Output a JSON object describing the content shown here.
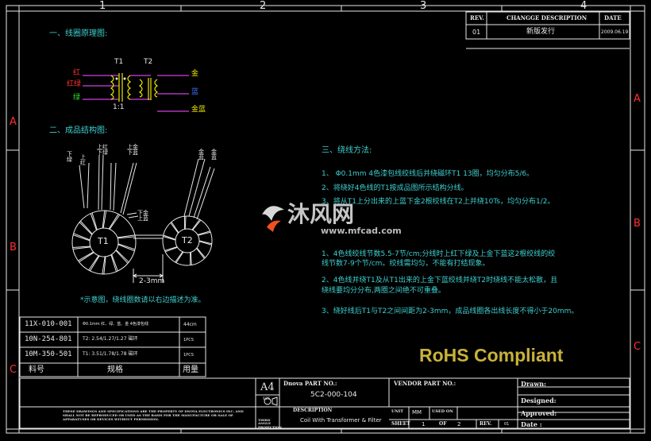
{
  "grid": {
    "cols": [
      "1",
      "2",
      "3",
      "4"
    ],
    "rows": [
      "A",
      "B",
      "C"
    ]
  },
  "revision": {
    "headers": {
      "rev": "REV.",
      "desc": "CHANGGE DESCRIPTION",
      "date": "DATE"
    },
    "rev": "01",
    "desc": "新版发行",
    "date": "2009.06.19"
  },
  "section1": {
    "title": "一、线圈原理图:"
  },
  "schematic": {
    "t1": "T1",
    "t2": "T2",
    "ratio": "1:1",
    "left_labels": [
      "红",
      "红绿",
      "绿"
    ],
    "right_labels": [
      "金",
      "蓝",
      "金蓝"
    ]
  },
  "section2": {
    "title": "二、成品结构图:"
  },
  "structure": {
    "lead_labels": [
      "下绿",
      "上红",
      "上红下绿",
      "上金下蓝",
      "金蓝",
      "金蓝"
    ],
    "mid_label": "下金上蓝",
    "t1": "T1",
    "t2": "T2",
    "gap": "2-3mm",
    "note": "*示意图，绕线圈数请以右边描述为准。"
  },
  "section3": {
    "title": "三、绕线方法:",
    "steps": [
      "1、 Φ0.1mm 4色漆包线绞线后并绕磁环T1 13圈，均匀分布5/6。",
      "2、将绕好4色线的T1按成品图所示结构分线。",
      "3、将从T1上分出来的上蓝下金2根绞线在T2上并绕10Ts，均匀分布1/2。"
    ],
    "notes": [
      "1、4色线绞线节数5.5-7节/cm;分线时上红下绿及上金下蓝这2根绞线的绞",
      "线节数7-9个节/cm。绞线需均匀，不能有打结现象。",
      "2、4色线并绕T1及从T1出来的上金下蓝绞线并绕T2时绕线不能太松散，且",
      "绕线要均分分布,两圈之间绝不可重叠。",
      "3、绕好线后T1与T2之间间距为2-3mm，成品线圈各出线长度不得小于20mm。"
    ]
  },
  "watermark": {
    "brand": "沐风网",
    "url": "www.mfcad.com"
  },
  "rohs": "RoHS Compliant",
  "bom": {
    "rows": [
      {
        "pn": "11X-010-001",
        "spec": "Φ0.1mm 红、绿、蓝、金 4色漆包线",
        "qty": "44cm"
      },
      {
        "pn": "10N-254-801",
        "spec": "T2: 2.54/1.27/1.27 磁环",
        "qty": "1PCS"
      },
      {
        "pn": "10M-350-501",
        "spec": "T1: 3.51/1.78/1.78 磁环",
        "qty": "1PCS"
      }
    ],
    "header": {
      "pn": "料号",
      "spec": "规格",
      "qty": "用量"
    }
  },
  "title_block": {
    "size": "A4",
    "size_label": "SIZE",
    "part_label": "Dnova PART NO.:",
    "part_no": "5C2-000-104",
    "vendor_label": "VENDOR PART NO.:",
    "drawn": "Drawn:",
    "designed": "Designed:",
    "approved": "Approved:",
    "date": "Date :",
    "desc_label": "DESCRIPTION",
    "description": "Coil With Transformer & Filter",
    "unit_label": "UNIT",
    "unit": "MM",
    "used_on": "USED ON",
    "sheet_label": "SHEET",
    "sheet": "1",
    "of_label": "OF",
    "sheet_total": "2",
    "rev_label": "REV.",
    "rev": "01",
    "angle_label": "THIRD ANGLE PROJECTION",
    "notice": "THESE DRAWINGS AND SPECIFICATIONS ARE THE PROPERTY OF DNOVA ELECTRONICS INC. AND SHALL NOT BE REPRODUCED OR USED AS THE BASIS FOR THE MANUFACTURE OR SALE OF APPARATUSES OR DEVICES WITHOUT PERMISSION."
  }
}
